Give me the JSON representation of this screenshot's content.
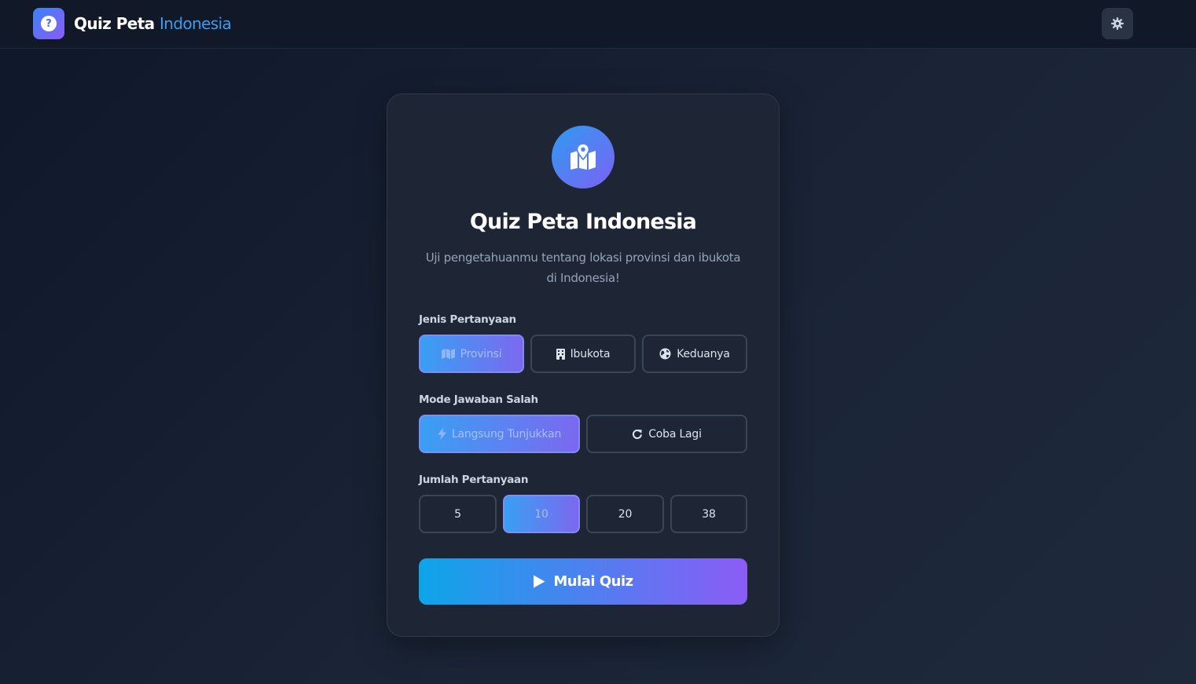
{
  "header": {
    "brand_part1": "Quiz Peta",
    "brand_part2": "Indonesia",
    "logo_icon": "question-circle-icon",
    "settings_icon": "gear-icon"
  },
  "card": {
    "hero_icon": "map-location-icon",
    "title": "Quiz Peta Indonesia",
    "subtitle_line1": "Uji pengetahuanmu tentang lokasi provinsi dan ibukota",
    "subtitle_line2": "di Indonesia!"
  },
  "question_type": {
    "label": "Jenis Pertanyaan",
    "options": [
      {
        "label": "Provinsi",
        "icon": "map-icon",
        "selected": true
      },
      {
        "label": "Ibukota",
        "icon": "building-icon",
        "selected": false
      },
      {
        "label": "Keduanya",
        "icon": "globe-icon",
        "selected": false
      }
    ]
  },
  "wrong_mode": {
    "label": "Mode Jawaban Salah",
    "options": [
      {
        "label": "Langsung Tunjukkan",
        "icon": "bolt-icon",
        "selected": true
      },
      {
        "label": "Coba Lagi",
        "icon": "redo-icon",
        "selected": false
      }
    ]
  },
  "question_count": {
    "label": "Jumlah Pertanyaan",
    "options": [
      {
        "label": "5",
        "selected": false
      },
      {
        "label": "10",
        "selected": true
      },
      {
        "label": "20",
        "selected": false
      },
      {
        "label": "38",
        "selected": false
      }
    ]
  },
  "start_button": {
    "label": "Mulai Quiz",
    "icon": "play-icon"
  },
  "colors": {
    "accent_start": "#0ea5e9",
    "accent_end": "#8b5cf6",
    "brand_blue": "#3d9bf0",
    "background": "#0f172a"
  }
}
